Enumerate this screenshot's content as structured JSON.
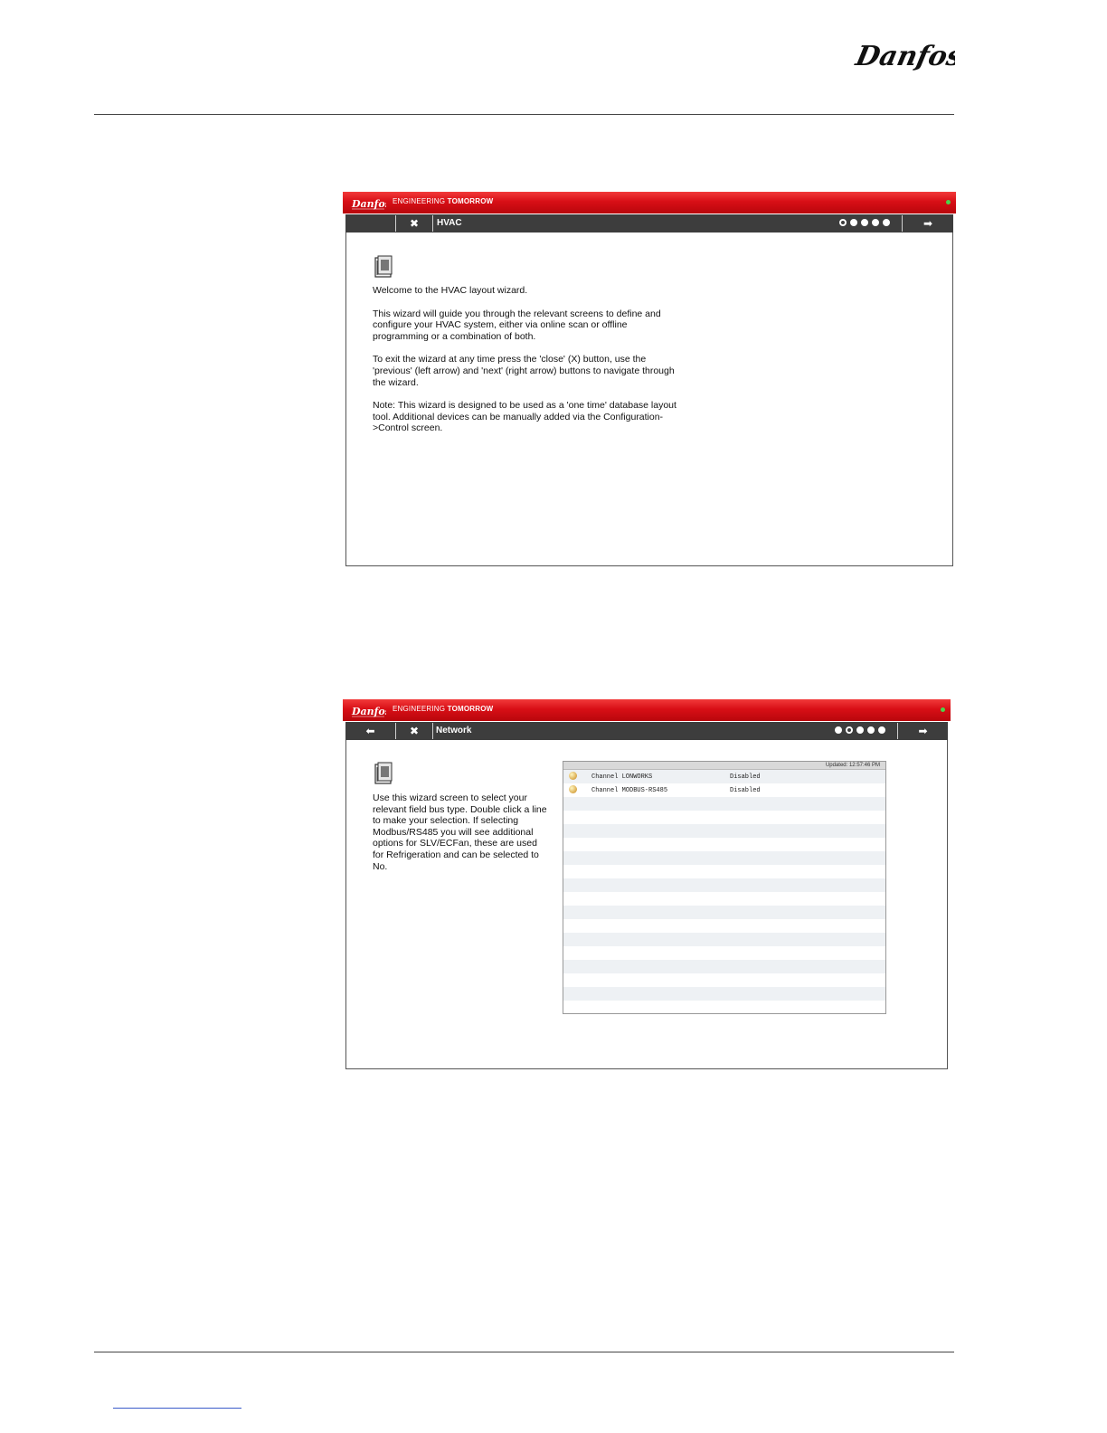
{
  "page": {
    "logo_text": "Danfoss"
  },
  "app_banner": {
    "brand": "Danfoss",
    "tagline_regular": "ENGINEERING ",
    "tagline_bold": "TOMORROW"
  },
  "screen1": {
    "close_label": "✖",
    "title": "HVAC",
    "next_label": "➡",
    "steps_total": 5,
    "active_step": 1,
    "paragraphs": [
      "Welcome to the HVAC layout wizard.",
      "This wizard will guide you through the relevant screens to define and configure your HVAC system, either via online scan or offline programming or a combination of both.",
      "To exit the wizard at any time press the 'close' (X) button, use the 'previous' (left arrow) and 'next' (right arrow) buttons to navigate through the wizard.",
      "Note: This wizard is designed to be used as a 'one time' database layout tool. Additional devices can be manually added via the Configuration->Control screen."
    ]
  },
  "screen2": {
    "prev_label": "⬅",
    "close_label": "✖",
    "title": "Network",
    "next_label": "➡",
    "steps_total": 5,
    "active_step": 2,
    "paragraph": "Use this wizard screen to select your relevant field bus type. Double click a line to make your selection. If selecting Modbus/RS485 you will see additional options for SLV/ECFan, these are used for Refrigeration and can be selected to No.",
    "grid": {
      "updated": "Updated: 12:57:46 PM",
      "rows": [
        {
          "name": "Channel LONWORKS",
          "status": "Disabled"
        },
        {
          "name": "Channel MODBUS-RS485",
          "status": "Disabled"
        }
      ],
      "empty_rows": 16
    }
  }
}
